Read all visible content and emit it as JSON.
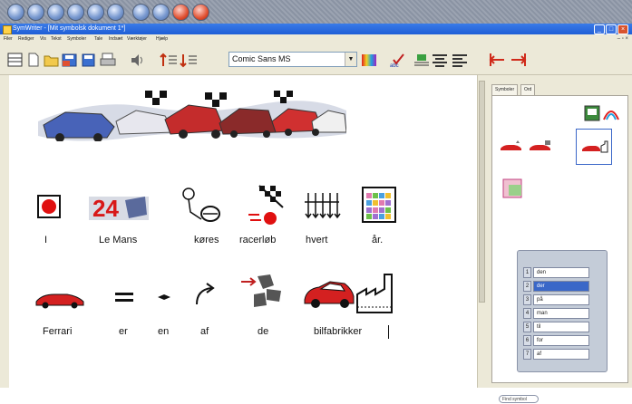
{
  "window": {
    "title": "SymWriter - [Mit symbolsk dokument 1*]"
  },
  "menu": [
    "Filer",
    "Rediger",
    "Vis",
    "Tekst",
    "Symboler",
    "Tale",
    "Indsæt",
    "Værktøjer",
    "Hjælp"
  ],
  "toolbar": {
    "font_name": "Comic Sans MS"
  },
  "document": {
    "line1": [
      "I",
      "Le Mans",
      "køres",
      "racerløb",
      "hvert",
      "år."
    ],
    "line2": [
      "Ferrari",
      "er",
      "en",
      "af",
      "de",
      "bilfabrikker"
    ]
  },
  "panel": {
    "tabs": [
      "Symboler",
      "Ord"
    ],
    "wordlist": [
      {
        "n": "1",
        "w": "den"
      },
      {
        "n": "2",
        "w": "der"
      },
      {
        "n": "3",
        "w": "på"
      },
      {
        "n": "4",
        "w": "man"
      },
      {
        "n": "5",
        "w": "til"
      },
      {
        "n": "6",
        "w": "for"
      },
      {
        "n": "7",
        "w": "af"
      }
    ],
    "selected_index": 1,
    "input_label": "Find symbol"
  }
}
